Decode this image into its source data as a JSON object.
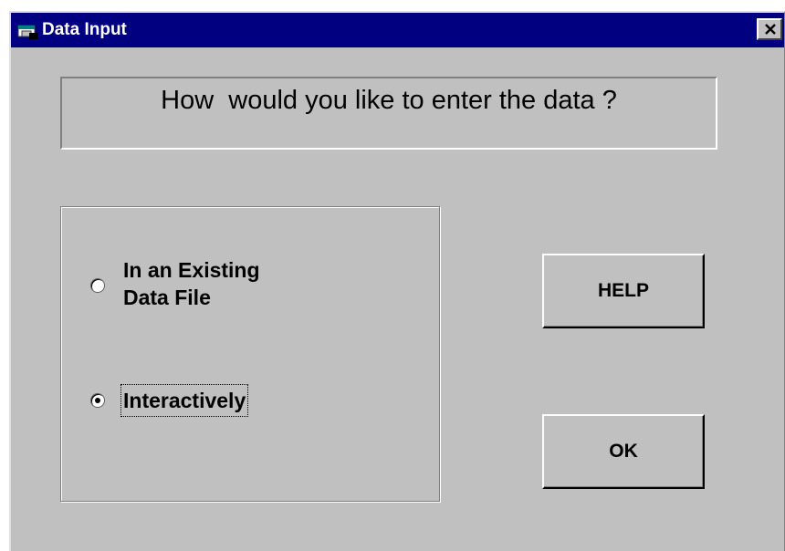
{
  "window": {
    "title": "Data Input",
    "colors": {
      "titlebar": "#000080",
      "face": "#c0c0c0"
    }
  },
  "question": {
    "text": "How  would you like to enter the data ?"
  },
  "options": [
    {
      "line1": "In an Existing",
      "line2": "Data File",
      "selected": false
    },
    {
      "label": "Interactively",
      "selected": true
    }
  ],
  "buttons": {
    "help": "HELP",
    "ok": "OK"
  },
  "icons": {
    "app": "app-window-icon",
    "close": "close-icon"
  }
}
